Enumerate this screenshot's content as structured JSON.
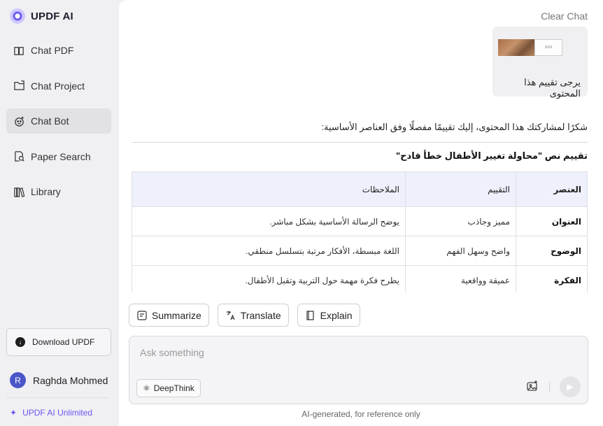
{
  "app": {
    "name": "UPDF AI"
  },
  "sidebar": {
    "items": [
      {
        "label": "Chat PDF",
        "icon": "book-chat-icon"
      },
      {
        "label": "Chat Project",
        "icon": "folder-chat-icon"
      },
      {
        "label": "Chat Bot",
        "icon": "bot-icon",
        "active": true
      },
      {
        "label": "Paper Search",
        "icon": "search-doc-icon"
      },
      {
        "label": "Library",
        "icon": "library-icon"
      }
    ],
    "download_label": "Download UPDF",
    "user_initial": "R",
    "user_name": "Raghda Mohmed",
    "unlimited_label": "UPDF AI Unlimited"
  },
  "main": {
    "clear_chat": "Clear Chat",
    "user_message": "يرجى تقييم هذا المحتوى",
    "reply_intro": "شكرًا لمشاركتك هذا المحتوى، إليك تقييمًا مفصلًا وفق العناصر الأساسية:",
    "reply_title": "تقييم نص \"محاولة تغيير الأطفال خطأ فادح\"",
    "table": {
      "headers": [
        "العنصر",
        "التقييم",
        "الملاحظات"
      ],
      "rows": [
        [
          "العنوان",
          "مميز وجاذب",
          "يوضح الرسالة الأساسية بشكل مباشر."
        ],
        [
          "الوضوح",
          "واضح وسهل الفهم",
          "اللغة مبسطة، الأفكار مرتبة بتسلسل منطقي."
        ],
        [
          "الفكرة",
          "عميقة وواقعية",
          "يطرح فكرة مهمة حول التربية وتقبل الأطفال."
        ]
      ]
    },
    "actions": {
      "summarize": "Summarize",
      "translate": "Translate",
      "explain": "Explain"
    },
    "input": {
      "placeholder": "Ask something",
      "deepthink": "DeepThink"
    },
    "footer_note": "AI-generated, for reference only"
  },
  "colors": {
    "accent": "#6b57f0",
    "avatar": "#4a56c8",
    "table_header": "#eef0fb"
  }
}
